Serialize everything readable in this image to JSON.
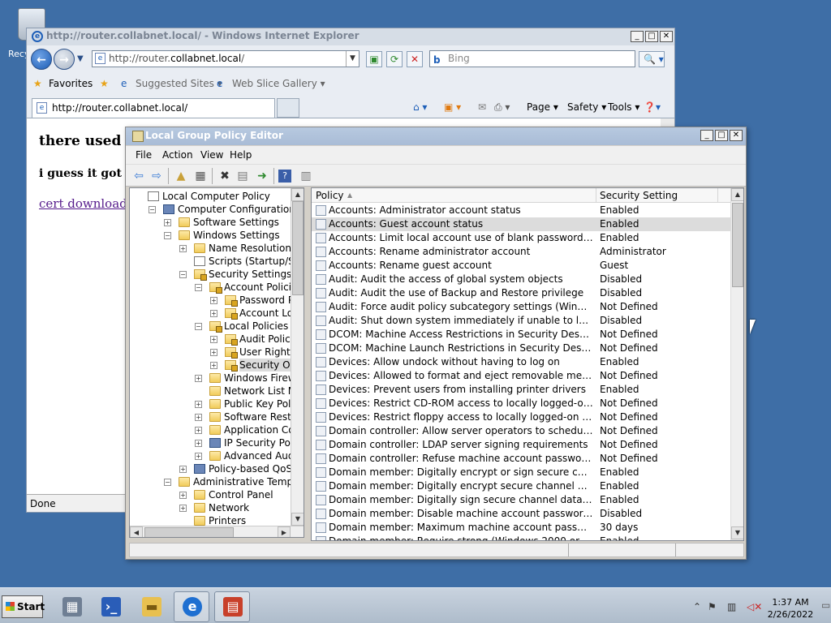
{
  "desktop": {
    "recycle_bin_label": "Recy"
  },
  "ie": {
    "title": "http://router.collabnet.local/ - Windows Internet Explorer",
    "address_prefix": "http://router.",
    "address_domain": "collabnet.local",
    "address_suffix": "/",
    "search_placeholder": "Bing",
    "favorites_label": "Favorites",
    "suggested_sites_label": "Suggested Sites ▾",
    "web_slice_label": "Web Slice Gallery ▾",
    "tab_label": "http://router.collabnet.local/",
    "commands": {
      "page": "Page ▾",
      "safety": "Safety ▾",
      "tools": "Tools ▾"
    },
    "content": {
      "heading1": "there used to",
      "heading2": "i guess it got los",
      "link": "cert download"
    },
    "status": "Done"
  },
  "gpe": {
    "title": "Local Group Policy Editor",
    "menu": [
      "File",
      "Action",
      "View",
      "Help"
    ],
    "tree": [
      {
        "label": "Local Computer Policy",
        "level": 0,
        "expander": "",
        "icon": "doc"
      },
      {
        "label": "Computer Configuration",
        "level": 1,
        "expander": "−",
        "icon": "pc"
      },
      {
        "label": "Software Settings",
        "level": 2,
        "expander": "+",
        "icon": "fold"
      },
      {
        "label": "Windows Settings",
        "level": 2,
        "expander": "−",
        "icon": "fold"
      },
      {
        "label": "Name Resolution Policy",
        "level": 3,
        "expander": "+",
        "icon": "fold"
      },
      {
        "label": "Scripts (Startup/Shutdow",
        "level": 3,
        "expander": "",
        "icon": "doc"
      },
      {
        "label": "Security Settings",
        "level": 3,
        "expander": "−",
        "icon": "lockf"
      },
      {
        "label": "Account Policies",
        "level": 4,
        "expander": "−",
        "icon": "lockf"
      },
      {
        "label": "Password Policy",
        "level": 5,
        "expander": "+",
        "icon": "lockf"
      },
      {
        "label": "Account Lockout",
        "level": 5,
        "expander": "+",
        "icon": "lockf"
      },
      {
        "label": "Local Policies",
        "level": 4,
        "expander": "−",
        "icon": "lockf"
      },
      {
        "label": "Audit Policy",
        "level": 5,
        "expander": "+",
        "icon": "lockf"
      },
      {
        "label": "User Rights Assig",
        "level": 5,
        "expander": "+",
        "icon": "lockf"
      },
      {
        "label": "Security Options",
        "level": 5,
        "expander": "+",
        "icon": "lockf",
        "selected": true
      },
      {
        "label": "Windows Firewall wit",
        "level": 4,
        "expander": "+",
        "icon": "fold"
      },
      {
        "label": "Network List Manage",
        "level": 4,
        "expander": "",
        "icon": "fold"
      },
      {
        "label": "Public Key Policies",
        "level": 4,
        "expander": "+",
        "icon": "fold"
      },
      {
        "label": "Software Restriction",
        "level": 4,
        "expander": "+",
        "icon": "fold"
      },
      {
        "label": "Application Control P",
        "level": 4,
        "expander": "+",
        "icon": "fold"
      },
      {
        "label": "IP Security Policies o",
        "level": 4,
        "expander": "+",
        "icon": "pc"
      },
      {
        "label": "Advanced Audit Polic",
        "level": 4,
        "expander": "+",
        "icon": "fold"
      },
      {
        "label": "Policy-based QoS",
        "level": 3,
        "expander": "+",
        "icon": "pc"
      },
      {
        "label": "Administrative Templates",
        "level": 2,
        "expander": "−",
        "icon": "fold"
      },
      {
        "label": "Control Panel",
        "level": 3,
        "expander": "+",
        "icon": "fold"
      },
      {
        "label": "Network",
        "level": 3,
        "expander": "+",
        "icon": "fold"
      },
      {
        "label": "Printers",
        "level": 3,
        "expander": "",
        "icon": "fold"
      }
    ],
    "columns": {
      "policy": "Policy",
      "setting": "Security Setting"
    },
    "policies": [
      {
        "policy": "Accounts: Administrator account status",
        "setting": "Enabled"
      },
      {
        "policy": "Accounts: Guest account status",
        "setting": "Enabled",
        "selected": true
      },
      {
        "policy": "Accounts: Limit local account use of blank passwords to console l...",
        "setting": "Enabled"
      },
      {
        "policy": "Accounts: Rename administrator account",
        "setting": "Administrator"
      },
      {
        "policy": "Accounts: Rename guest account",
        "setting": "Guest"
      },
      {
        "policy": "Audit: Audit the access of global system objects",
        "setting": "Disabled"
      },
      {
        "policy": "Audit: Audit the use of Backup and Restore privilege",
        "setting": "Disabled"
      },
      {
        "policy": "Audit: Force audit policy subcategory settings (Windows Vista or l...",
        "setting": "Not Defined"
      },
      {
        "policy": "Audit: Shut down system immediately if unable to log security audits",
        "setting": "Disabled"
      },
      {
        "policy": "DCOM: Machine Access Restrictions in Security Descriptor Definiti...",
        "setting": "Not Defined"
      },
      {
        "policy": "DCOM: Machine Launch Restrictions in Security Descriptor Definiti...",
        "setting": "Not Defined"
      },
      {
        "policy": "Devices: Allow undock without having to log on",
        "setting": "Enabled"
      },
      {
        "policy": "Devices: Allowed to format and eject removable media",
        "setting": "Not Defined"
      },
      {
        "policy": "Devices: Prevent users from installing printer drivers",
        "setting": "Enabled"
      },
      {
        "policy": "Devices: Restrict CD-ROM access to locally logged-on user only",
        "setting": "Not Defined"
      },
      {
        "policy": "Devices: Restrict floppy access to locally logged-on user only",
        "setting": "Not Defined"
      },
      {
        "policy": "Domain controller: Allow server operators to schedule tasks",
        "setting": "Not Defined"
      },
      {
        "policy": "Domain controller: LDAP server signing requirements",
        "setting": "Not Defined"
      },
      {
        "policy": "Domain controller: Refuse machine account password changes",
        "setting": "Not Defined"
      },
      {
        "policy": "Domain member: Digitally encrypt or sign secure channel data (al...",
        "setting": "Enabled"
      },
      {
        "policy": "Domain member: Digitally encrypt secure channel data (when pos...",
        "setting": "Enabled"
      },
      {
        "policy": "Domain member: Digitally sign secure channel data (when possible)",
        "setting": "Enabled"
      },
      {
        "policy": "Domain member: Disable machine account password changes",
        "setting": "Disabled"
      },
      {
        "policy": "Domain member: Maximum machine account password age",
        "setting": "30 days"
      },
      {
        "policy": "Domain member: Require strong (Windows 2000 or later) session...",
        "setting": "Enabled"
      }
    ]
  },
  "taskbar": {
    "start_label": "Start",
    "apps": [
      "server-manager",
      "powershell",
      "explorer",
      "internet-explorer",
      "group-policy"
    ],
    "clock_time": "1:37 AM",
    "clock_date": "2/26/2022"
  }
}
